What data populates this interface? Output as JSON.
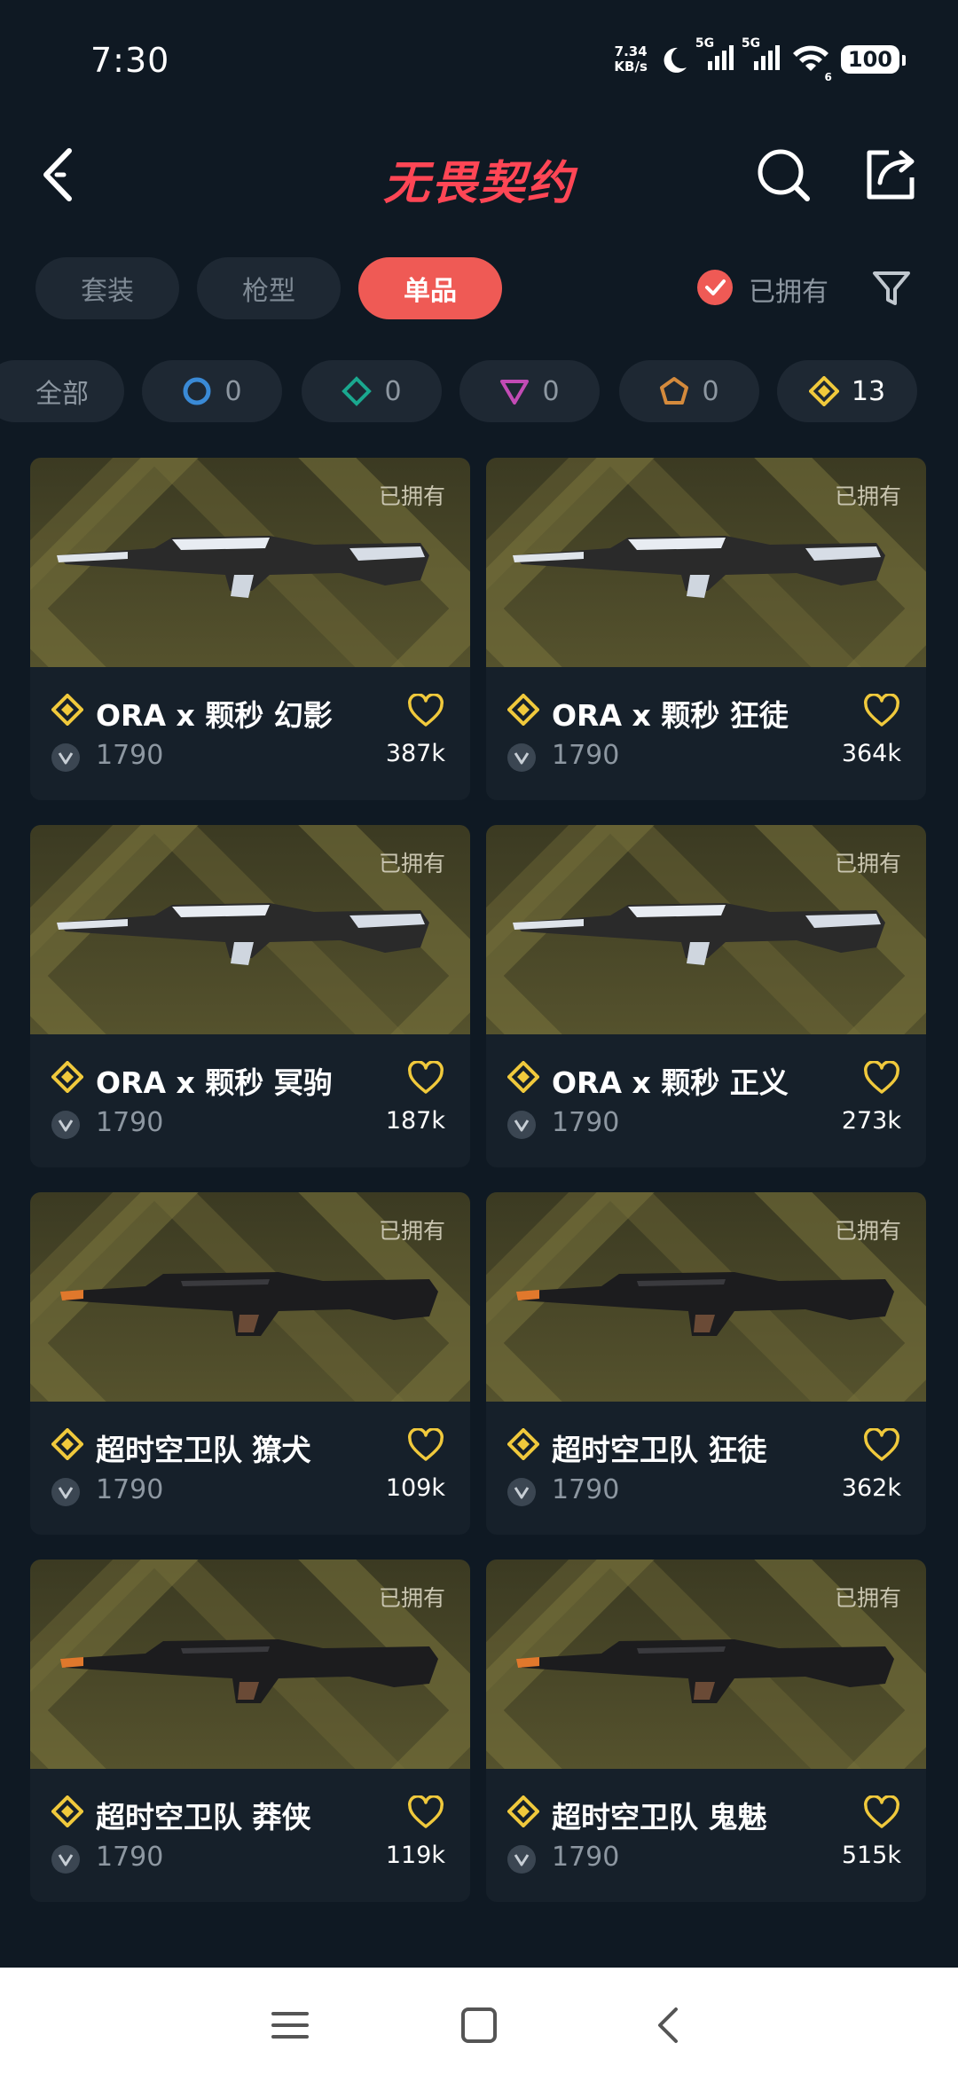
{
  "status": {
    "time": "7:30",
    "netspeed_value": "7.34",
    "netspeed_unit": "KB/s",
    "battery": "100",
    "sim1": "5G",
    "sim2": "5G",
    "wifi_badge": "6"
  },
  "header": {
    "title": "无畏契约"
  },
  "tabs": [
    {
      "label": "套装"
    },
    {
      "label": "枪型"
    },
    {
      "label": "单品"
    }
  ],
  "owned_filter": {
    "label": "已拥有"
  },
  "rarity_chips": [
    {
      "label": "全部"
    },
    {
      "icon": "select-edition-icon",
      "color": "#3a8ad6",
      "count": "0"
    },
    {
      "icon": "deluxe-edition-icon",
      "color": "#1aa88f",
      "count": "0"
    },
    {
      "icon": "premium-edition-icon",
      "color": "#c34bb5",
      "count": "0"
    },
    {
      "icon": "ultra-edition-icon",
      "color": "#d48a3c",
      "count": "0"
    },
    {
      "icon": "exclusive-edition-icon",
      "color": "#f0c93c",
      "count": "13"
    }
  ],
  "cards": [
    {
      "title": "ORA x 颗秒 幻影",
      "price": "1790",
      "likes": "387k",
      "owned": "已拥有",
      "theme": "light"
    },
    {
      "title": "ORA x 颗秒 狂徒",
      "price": "1790",
      "likes": "364k",
      "owned": "已拥有",
      "theme": "light"
    },
    {
      "title": "ORA x 颗秒 冥驹",
      "price": "1790",
      "likes": "187k",
      "owned": "已拥有",
      "theme": "light"
    },
    {
      "title": "ORA x 颗秒 正义",
      "price": "1790",
      "likes": "273k",
      "owned": "已拥有",
      "theme": "light"
    },
    {
      "title": "超时空卫队 獠犬",
      "price": "1790",
      "likes": "109k",
      "owned": "已拥有",
      "theme": "dark"
    },
    {
      "title": "超时空卫队 狂徒",
      "price": "1790",
      "likes": "362k",
      "owned": "已拥有",
      "theme": "dark"
    },
    {
      "title": "超时空卫队 莽侠",
      "price": "1790",
      "likes": "119k",
      "owned": "已拥有",
      "theme": "dark"
    },
    {
      "title": "超时空卫队 鬼魅",
      "price": "1790",
      "likes": "515k",
      "owned": "已拥有",
      "theme": "dark"
    }
  ],
  "colors": {
    "accent": "#ef5a55",
    "title": "#ff4655",
    "gold": "#f0c93c",
    "background": "#0f1923"
  }
}
